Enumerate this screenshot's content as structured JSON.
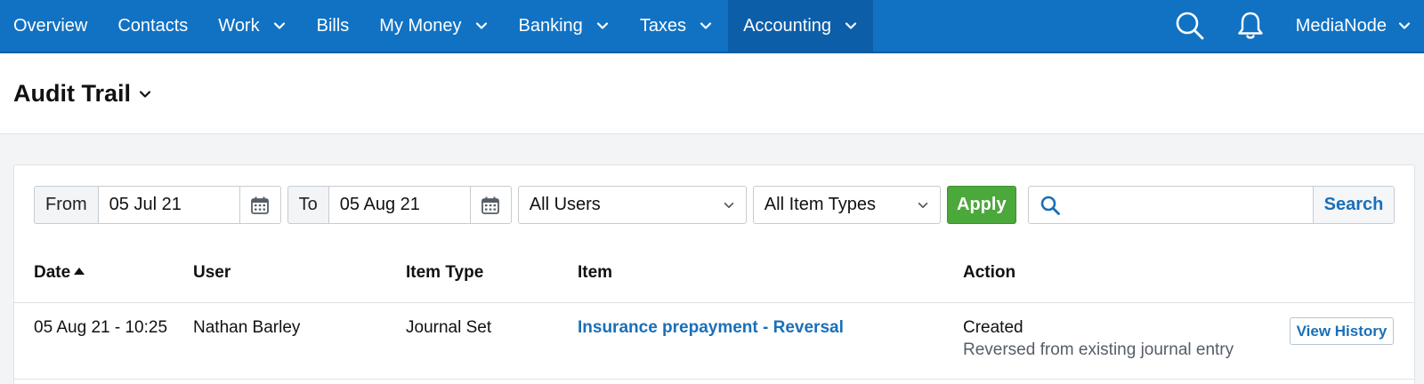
{
  "nav": {
    "items": [
      {
        "label": "Overview",
        "dropdown": false
      },
      {
        "label": "Contacts",
        "dropdown": false
      },
      {
        "label": "Work",
        "dropdown": true
      },
      {
        "label": "Bills",
        "dropdown": false
      },
      {
        "label": "My Money",
        "dropdown": true
      },
      {
        "label": "Banking",
        "dropdown": true
      },
      {
        "label": "Taxes",
        "dropdown": true
      },
      {
        "label": "Accounting",
        "dropdown": true,
        "active": true
      }
    ],
    "org_name": "MediaNode",
    "icons": [
      "search-icon",
      "bell-icon"
    ]
  },
  "page": {
    "title": "Audit Trail"
  },
  "filters": {
    "from_label": "From",
    "from_value": "05 Jul 21",
    "to_label": "To",
    "to_value": "05 Aug 21",
    "users_selected": "All Users",
    "item_types_selected": "All Item Types",
    "apply_label": "Apply",
    "search_placeholder": "",
    "search_label": "Search"
  },
  "table": {
    "headers": {
      "date": "Date",
      "user": "User",
      "item_type": "Item Type",
      "item": "Item",
      "action": "Action"
    },
    "sort": {
      "column": "date",
      "direction": "ascending"
    },
    "rows": [
      {
        "date": "05 Aug 21 - 10:25",
        "user": "Nathan Barley",
        "item_type": "Journal Set",
        "item": "Insurance prepayment - Reversal",
        "action": "Created",
        "action_detail": "Reversed from existing journal entry",
        "history_label": "View History"
      }
    ]
  },
  "colors": {
    "nav_bg": "#1172c3",
    "nav_active": "#0c5ea8",
    "apply_green": "#4ba83a",
    "link_blue": "#1a6fb8"
  }
}
